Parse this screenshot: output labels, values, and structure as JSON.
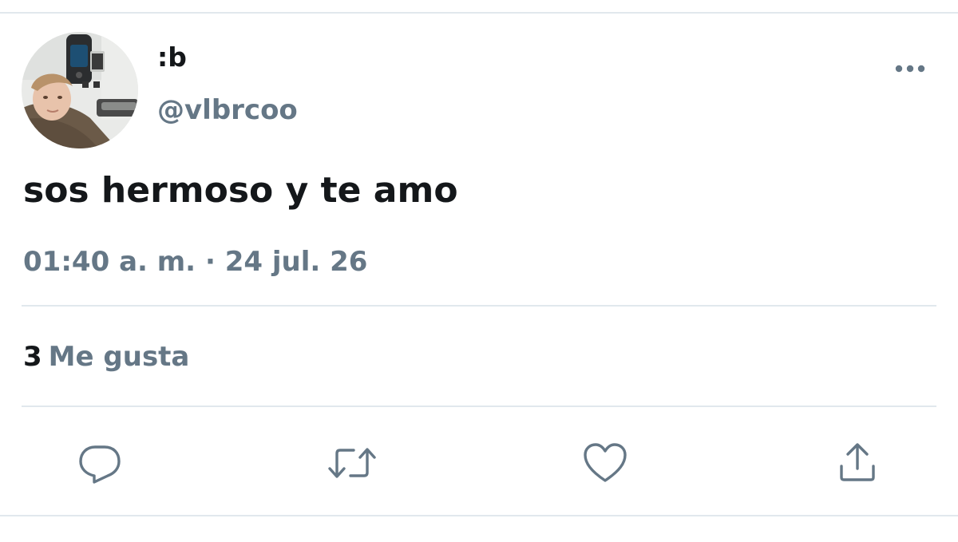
{
  "tweet": {
    "display_name": ":b",
    "handle": "@vlbrcoo",
    "text": "sos hermoso y te amo",
    "timestamp": "01:40 a. m. · 24 jul. 26",
    "likes": {
      "count": "3",
      "label": "Me gusta"
    }
  },
  "icons": {
    "more": "more-horizontal-icon",
    "reply": "reply-bubble-icon",
    "retweet": "retweet-icon",
    "like": "heart-icon",
    "share": "share-upload-icon"
  },
  "colors": {
    "text_primary": "#14171a",
    "text_secondary": "#657786",
    "divider": "#e1e8ed",
    "background": "#ffffff"
  }
}
